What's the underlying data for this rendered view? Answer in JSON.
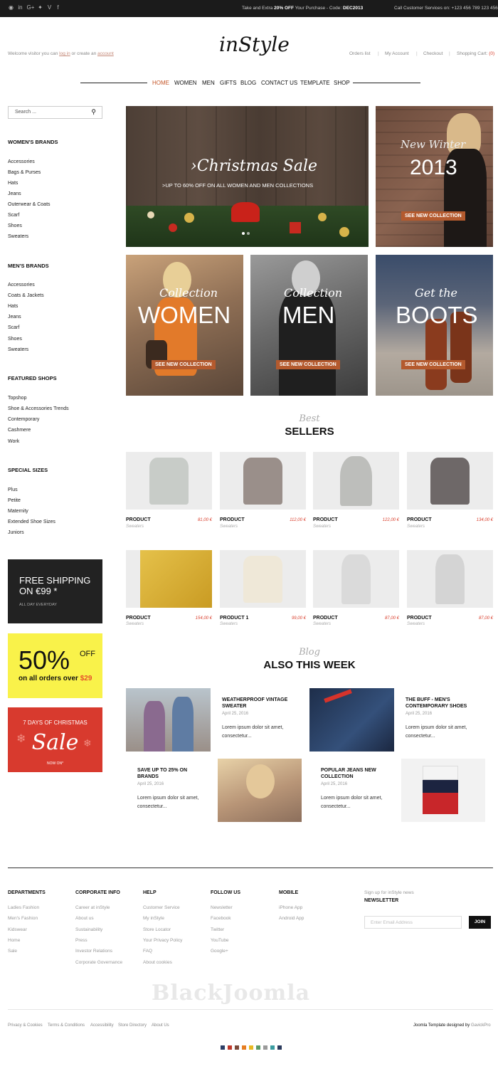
{
  "topbar": {
    "social_icons": [
      "rss-icon",
      "linkedin-icon",
      "google-plus-icon",
      "twitter-icon",
      "vimeo-icon",
      "facebook-icon"
    ],
    "social_glyphs": [
      "◉",
      "in",
      "G+",
      "✦",
      "V",
      "f"
    ],
    "promo_pre": "Take and Extra",
    "promo_bold": "20% OFF",
    "promo_mid": "Your Purchase - Code:",
    "promo_code": "DEC2013",
    "call": "Call Customer Services on: +123 456 789 123 456"
  },
  "header": {
    "logo": "inStyle",
    "welcome_pre": "Welcome visitor you can",
    "login": "log in",
    "welcome_mid": "or create an",
    "account": "account",
    "links": [
      "Orders list",
      "My Account",
      "Checkout"
    ],
    "cart_label": "Shopping Cart",
    "cart_count": "(0)"
  },
  "nav": {
    "items": [
      "HOME",
      "WOMEN",
      "MEN",
      "GIFTS",
      "BLOG",
      "CONTACT US",
      "TEMPLATE",
      "SHOP"
    ],
    "active": "HOME"
  },
  "sidebar": {
    "search_placeholder": "Search ...",
    "groups": [
      {
        "title": "WOMEN'S BRANDS",
        "items": [
          "Accessories",
          "Bags & Purses",
          "Hats",
          "Jeans",
          "Outerwear & Coats",
          "Scarf",
          "Shoes",
          "Sweaters"
        ]
      },
      {
        "title": "MEN'S BRANDS",
        "items": [
          "Accessories",
          "Coats & Jackets",
          "Hats",
          "Jeans",
          "Scarf",
          "Shoes",
          "Sweaters"
        ]
      },
      {
        "title": "FEATURED SHOPS",
        "items": [
          "Topshop",
          "Shoe & Accessories Trends",
          "Contemporary",
          "Cashmere",
          "Work"
        ]
      },
      {
        "title": "SPECIAL SIZES",
        "items": [
          "Plus",
          "Petite",
          "Maternity",
          "Extended Shoe Sizes",
          "Juniors"
        ]
      }
    ]
  },
  "promos": {
    "shipping_line1": "FREE SHIPPING",
    "shipping_line2": "ON €99 *",
    "shipping_sub": "ALL DAY EVERYDAY",
    "off_big": "50%",
    "off_word": "OFF",
    "off_line": "on all orders over",
    "off_amount": "$29",
    "xmas_top": "7 DAYS OF CHRISTMAS",
    "xmas_script": "Sale",
    "xmas_btn": "NOW ON*"
  },
  "banners": {
    "christmas_title": "Christmas Sale",
    "christmas_sub": ">UP TO 60% OFF ON ALL WOMEN AND MEN COLLECTIONS",
    "winter_script": "New Winter",
    "winter_year": "2013",
    "see_new": "SEE NEW COLLECTION",
    "cats": [
      {
        "script": "Collection",
        "big": "WOMEN"
      },
      {
        "script": "Collection",
        "big": "MEN"
      },
      {
        "script": "Get the",
        "big": "BOOTS"
      }
    ]
  },
  "bestsellers": {
    "script": "Best",
    "title": "SELLERS",
    "products": [
      {
        "name": "PRODUCT",
        "cat": "Sweaters",
        "price": "81,00 €"
      },
      {
        "name": "PRODUCT",
        "cat": "Sweaters",
        "price": "112,00 €"
      },
      {
        "name": "PRODUCT",
        "cat": "Sweaters",
        "price": "122,00 €"
      },
      {
        "name": "PRODUCT",
        "cat": "Sweaters",
        "price": "134,00 €"
      },
      {
        "name": "PRODUCT",
        "cat": "Sweaters",
        "price": "154,00 €"
      },
      {
        "name": "PRODUCT 1",
        "cat": "Sweaters",
        "price": "99,00 €"
      },
      {
        "name": "PRODUCT",
        "cat": "Sweaters",
        "price": "87,00 €"
      },
      {
        "name": "PRODUCT",
        "cat": "Sweaters",
        "price": "87,00 €"
      }
    ]
  },
  "blog": {
    "script": "Blog",
    "title": "ALSO THIS WEEK",
    "posts": [
      {
        "title": "WEATHERPROOF VINTAGE SWEATER",
        "date": "April 25, 2016",
        "excerpt": "Lorem ipsum dolor sit amet, consectetur..."
      },
      {
        "title": "THE BUFF - MEN'S CONTEMPORARY SHOES",
        "date": "April 25, 2016",
        "excerpt": "Lorem ipsum dolor sit amet, consectetur..."
      },
      {
        "title": "SAVE UP TO 25% ON BRANDS",
        "date": "April 25, 2016",
        "excerpt": "Lorem ipsum dolor sit amet, consectetur..."
      },
      {
        "title": "POPULAR JEANS NEW COLLECTION",
        "date": "April 25, 2016",
        "excerpt": "Lorem ipsum dolor sit amet, consectetur..."
      }
    ]
  },
  "footer": {
    "columns": [
      {
        "title": "DEPARTMENTS",
        "items": [
          "Ladies Fashion",
          "Men's Fashion",
          "Kidswear",
          "Home",
          "Sale"
        ]
      },
      {
        "title": "CORPORATE INFO",
        "items": [
          "Career at inStyle",
          "About us",
          "Sustainability",
          "Press",
          "Investor Relations",
          "Corporate Governance"
        ]
      },
      {
        "title": "HELP",
        "items": [
          "Customer Service",
          "My inStyle",
          "Store Locator",
          "Your Privacy Policy",
          "FAQ",
          "About cookies"
        ]
      },
      {
        "title": "FOLLOW US",
        "items": [
          "Newsletter",
          "Facebook",
          "Twitter",
          "YouTube",
          "Google+"
        ]
      },
      {
        "title": "MOBILE",
        "items": [
          "iPhone App",
          "Android App"
        ]
      }
    ],
    "newsletter_sub": "Sign up for inStyle news",
    "newsletter_title": "NEWSLETTER",
    "email_placeholder": "Enter Email Address",
    "join": "JOIN",
    "watermark": "BlackJoomla",
    "bottom_links": [
      "Privacy & Cookies",
      "Terms & Conditions",
      "Accessibility",
      "Store Directory",
      "About Us"
    ],
    "credit_pre": "Joomla Template designed by",
    "credit_name": "GavickPro",
    "swatches": [
      "#2c3e66",
      "#c0392b",
      "#7a4a3a",
      "#e67e22",
      "#e8b923",
      "#5b9a68",
      "#9a9a9a",
      "#3a9ca0",
      "#2b3a5c"
    ]
  }
}
